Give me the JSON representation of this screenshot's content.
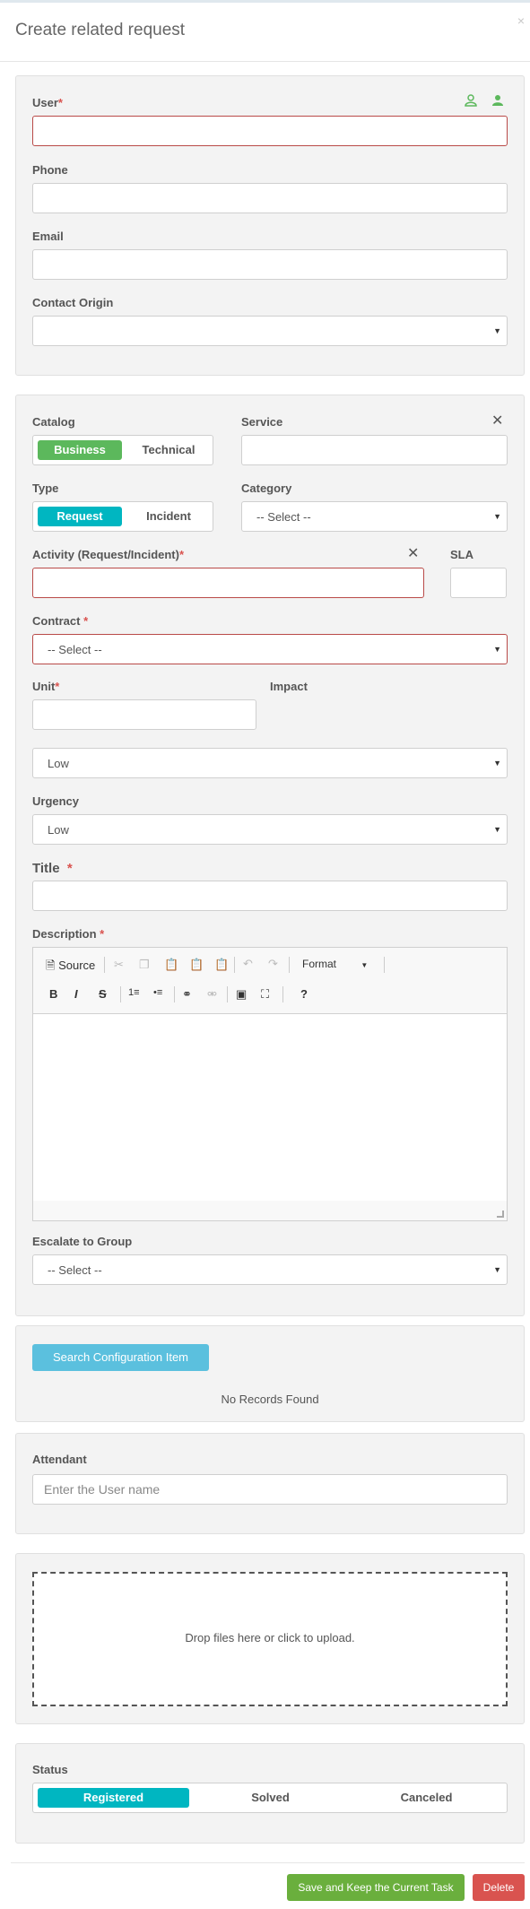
{
  "modal": {
    "title": "Create related request",
    "close": "×"
  },
  "user_panel": {
    "user_label": "User",
    "phone_label": "Phone",
    "email_label": "Email",
    "contact_origin_label": "Contact Origin"
  },
  "request_panel": {
    "catalog_label": "Catalog",
    "catalog_options": [
      "Business",
      "Technical"
    ],
    "catalog_selected": "Business",
    "service_label": "Service",
    "type_label": "Type",
    "type_options": [
      "Request",
      "Incident"
    ],
    "type_selected": "Request",
    "category_label": "Category",
    "category_value": "-- Select --",
    "activity_label": "Activity (Request/Incident)",
    "sla_label": "SLA",
    "contract_label": "Contract",
    "contract_value": "-- Select --",
    "unit_label": "Unit",
    "impact_label": "Impact",
    "impact_value": "Low",
    "urgency_label": "Urgency",
    "urgency_value": "Low",
    "title_label": "Title",
    "description_label": "Description",
    "editor": {
      "source_label": "Source",
      "format_label": "Format"
    },
    "escalate_label": "Escalate to Group",
    "escalate_value": "-- Select --",
    "required_mark": "*"
  },
  "config_panel": {
    "search_button": "Search Configuration Item",
    "empty_text": "No Records Found"
  },
  "attendant_panel": {
    "label": "Attendant",
    "placeholder": "Enter the User name"
  },
  "upload_panel": {
    "dropzone_text": "Drop files here or click to upload."
  },
  "status_panel": {
    "label": "Status",
    "options": [
      "Registered",
      "Solved",
      "Canceled"
    ],
    "selected": "Registered"
  },
  "footer": {
    "save_button": "Save and Keep the Current Task",
    "delete_button": "Delete"
  },
  "colors": {
    "green": "#5cb85c",
    "teal": "#00b6c1",
    "info": "#5bc0de",
    "danger": "#d9534f",
    "save_green": "#6aaf3d"
  }
}
